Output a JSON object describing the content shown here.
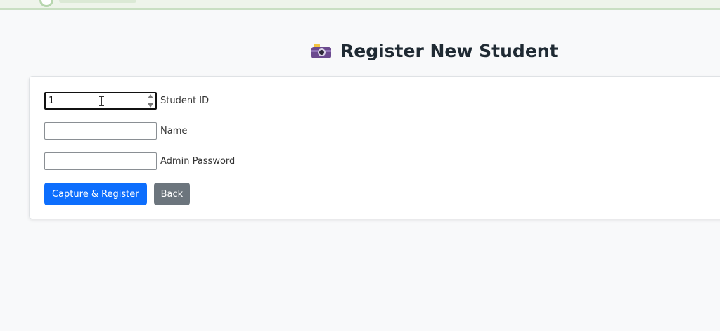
{
  "page": {
    "title": "Register New Student"
  },
  "form": {
    "student_id": {
      "label": "Student ID",
      "value": "1"
    },
    "name": {
      "label": "Name",
      "value": ""
    },
    "admin_password": {
      "label": "Admin Password",
      "value": ""
    },
    "buttons": {
      "register": "Capture & Register",
      "back": "Back"
    }
  },
  "colors": {
    "primary": "#0d6efd",
    "secondary": "#6c757d",
    "page_background": "#f8f9fa",
    "card_background": "#ffffff"
  },
  "icons": {
    "title_icon": "camera-with-flash-icon",
    "spinner": "number-spinner-icon",
    "cursor": "text-cursor-icon"
  }
}
